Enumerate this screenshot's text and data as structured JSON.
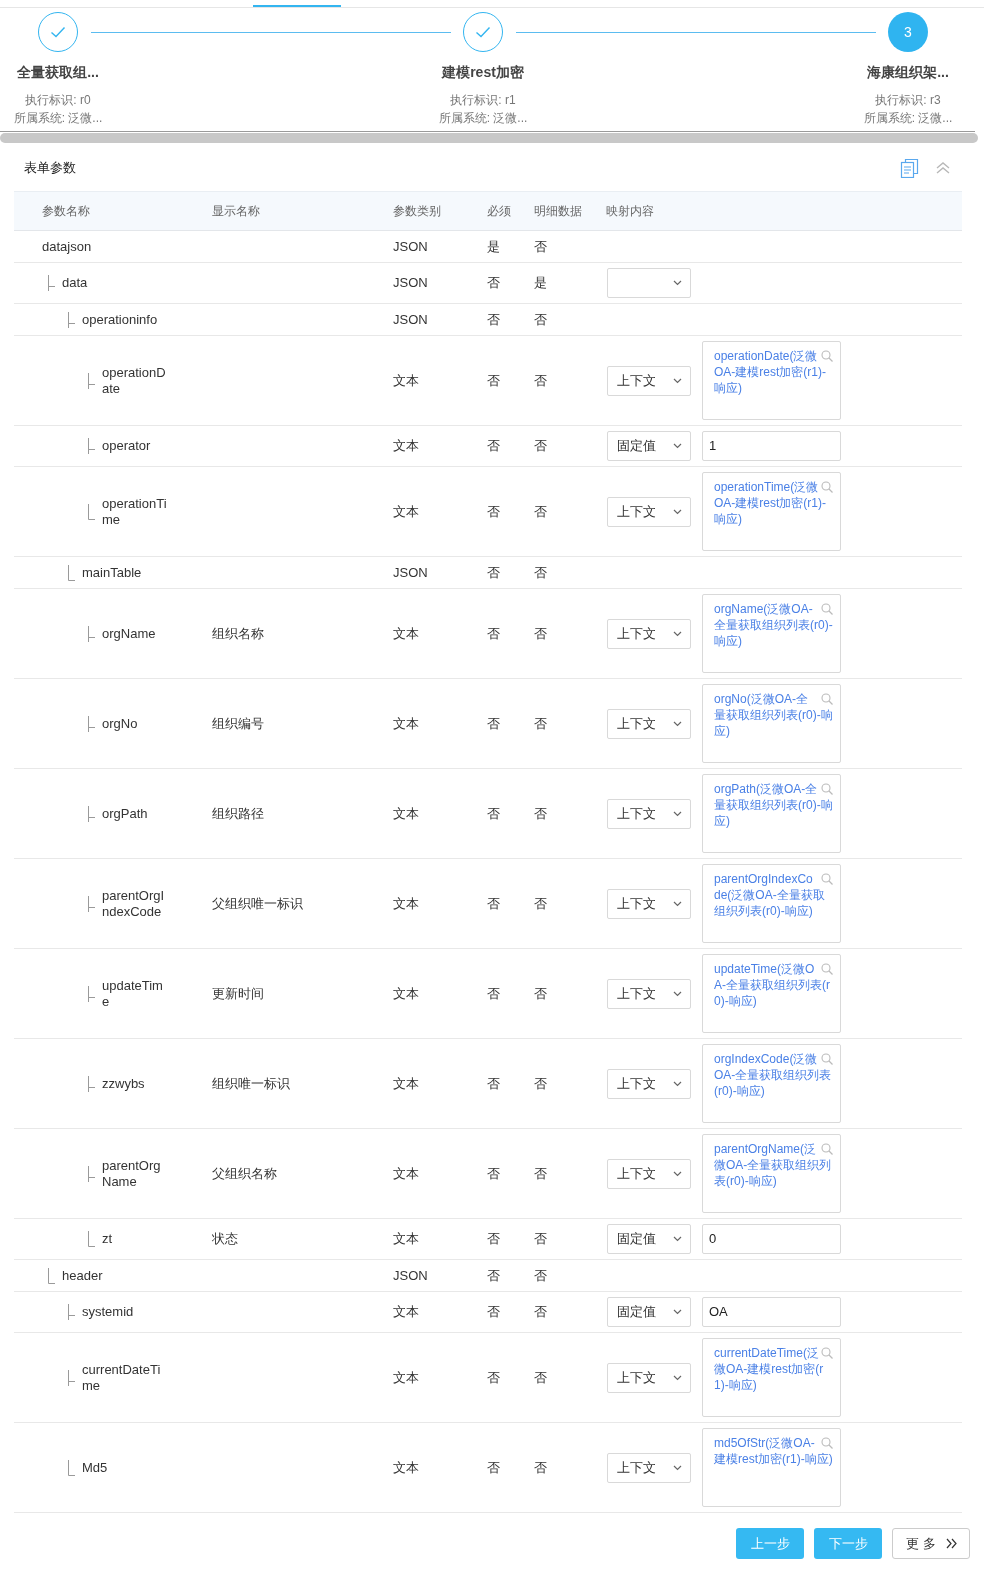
{
  "steps": [
    {
      "title": "全量获取组...",
      "completed": true,
      "exec_label": "执行标识: r0",
      "system": "所属系统: 泛微..."
    },
    {
      "title": "建模rest加密",
      "completed": true,
      "exec_label": "执行标识: r1",
      "system": "所属系统: 泛微..."
    },
    {
      "title": "海康组织架...",
      "completed": false,
      "number": "3",
      "exec_label": "执行标识: r3",
      "system": "所属系统: 泛微..."
    }
  ],
  "section": {
    "title": "表单参数"
  },
  "table": {
    "columns": [
      "参数名称",
      "显示名称",
      "参数类别",
      "必须",
      "明细数据",
      "映射内容"
    ],
    "rows": [
      {
        "name": "datajson",
        "type": "JSON",
        "required": "是",
        "detail": "否",
        "children": [
          {
            "name": "data",
            "type": "JSON",
            "required": "否",
            "detail": "是",
            "mapping": {
              "kind": "select"
            },
            "children": [
              {
                "name": "operationinfo",
                "type": "JSON",
                "required": "否",
                "detail": "否",
                "children": [
                  {
                    "name": "operationDate",
                    "type": "文本",
                    "required": "否",
                    "detail": "否",
                    "mapping": {
                      "kind": "context",
                      "source": "上下文",
                      "value": "operationDate(泛微OA-建模rest加密(r1)-响应)"
                    }
                  },
                  {
                    "name": "operator",
                    "type": "文本",
                    "required": "否",
                    "detail": "否",
                    "mapping": {
                      "kind": "fixed",
                      "source": "固定值",
                      "value": "1"
                    }
                  },
                  {
                    "name": "operationTime",
                    "type": "文本",
                    "required": "否",
                    "detail": "否",
                    "mapping": {
                      "kind": "context",
                      "source": "上下文",
                      "value": "operationTime(泛微OA-建模rest加密(r1)-响应)"
                    }
                  }
                ]
              },
              {
                "name": "mainTable",
                "type": "JSON",
                "required": "否",
                "detail": "否",
                "children": [
                  {
                    "name": "orgName",
                    "display": "组织名称",
                    "type": "文本",
                    "required": "否",
                    "detail": "否",
                    "mapping": {
                      "kind": "context",
                      "source": "上下文",
                      "value": "orgName(泛微OA-全量获取组织列表(r0)-响应)"
                    }
                  },
                  {
                    "name": "orgNo",
                    "display": "组织编号",
                    "type": "文本",
                    "required": "否",
                    "detail": "否",
                    "mapping": {
                      "kind": "context",
                      "source": "上下文",
                      "value": "orgNo(泛微OA-全量获取组织列表(r0)-响应)"
                    }
                  },
                  {
                    "name": "orgPath",
                    "display": "组织路径",
                    "type": "文本",
                    "required": "否",
                    "detail": "否",
                    "mapping": {
                      "kind": "context",
                      "source": "上下文",
                      "value": "orgPath(泛微OA-全量获取组织列表(r0)-响应)"
                    }
                  },
                  {
                    "name": "parentOrgIndexCode",
                    "display": "父组织唯一标识",
                    "type": "文本",
                    "required": "否",
                    "detail": "否",
                    "mapping": {
                      "kind": "context",
                      "source": "上下文",
                      "value": "parentOrgIndexCode(泛微OA-全量获取组织列表(r0)-响应)"
                    }
                  },
                  {
                    "name": "updateTime",
                    "display": "更新时间",
                    "type": "文本",
                    "required": "否",
                    "detail": "否",
                    "mapping": {
                      "kind": "context",
                      "source": "上下文",
                      "value": "updateTime(泛微OA-全量获取组织列表(r0)-响应)"
                    }
                  },
                  {
                    "name": "zzwybs",
                    "display": "组织唯一标识",
                    "type": "文本",
                    "required": "否",
                    "detail": "否",
                    "mapping": {
                      "kind": "context",
                      "source": "上下文",
                      "value": "orgIndexCode(泛微OA-全量获取组织列表(r0)-响应)"
                    }
                  },
                  {
                    "name": "parentOrgName",
                    "display": "父组织名称",
                    "type": "文本",
                    "required": "否",
                    "detail": "否",
                    "mapping": {
                      "kind": "context",
                      "source": "上下文",
                      "value": "parentOrgName(泛微OA-全量获取组织列表(r0)-响应)"
                    }
                  },
                  {
                    "name": "zt",
                    "display": "状态",
                    "type": "文本",
                    "required": "否",
                    "detail": "否",
                    "mapping": {
                      "kind": "fixed",
                      "source": "固定值",
                      "value": "0"
                    }
                  }
                ]
              }
            ]
          },
          {
            "name": "header",
            "type": "JSON",
            "required": "否",
            "detail": "否",
            "children": [
              {
                "name": "systemid",
                "type": "文本",
                "required": "否",
                "detail": "否",
                "mapping": {
                  "kind": "fixed",
                  "source": "固定值",
                  "value": "OA"
                }
              },
              {
                "name": "currentDateTime",
                "type": "文本",
                "required": "否",
                "detail": "否",
                "mapping": {
                  "kind": "context",
                  "source": "上下文",
                  "value": "currentDateTime(泛微OA-建模rest加密(r1)-响应)"
                }
              },
              {
                "name": "Md5",
                "type": "文本",
                "required": "否",
                "detail": "否",
                "mapping": {
                  "kind": "context",
                  "source": "上下文",
                  "value": "md5OfStr(泛微OA-建模rest加密(r1)-响应)"
                }
              }
            ]
          }
        ]
      }
    ]
  },
  "buttons": [
    {
      "label": "上一步",
      "kind": "primary"
    },
    {
      "label": "下一步",
      "kind": "primary"
    },
    {
      "label": "更多",
      "kind": "more"
    }
  ]
}
